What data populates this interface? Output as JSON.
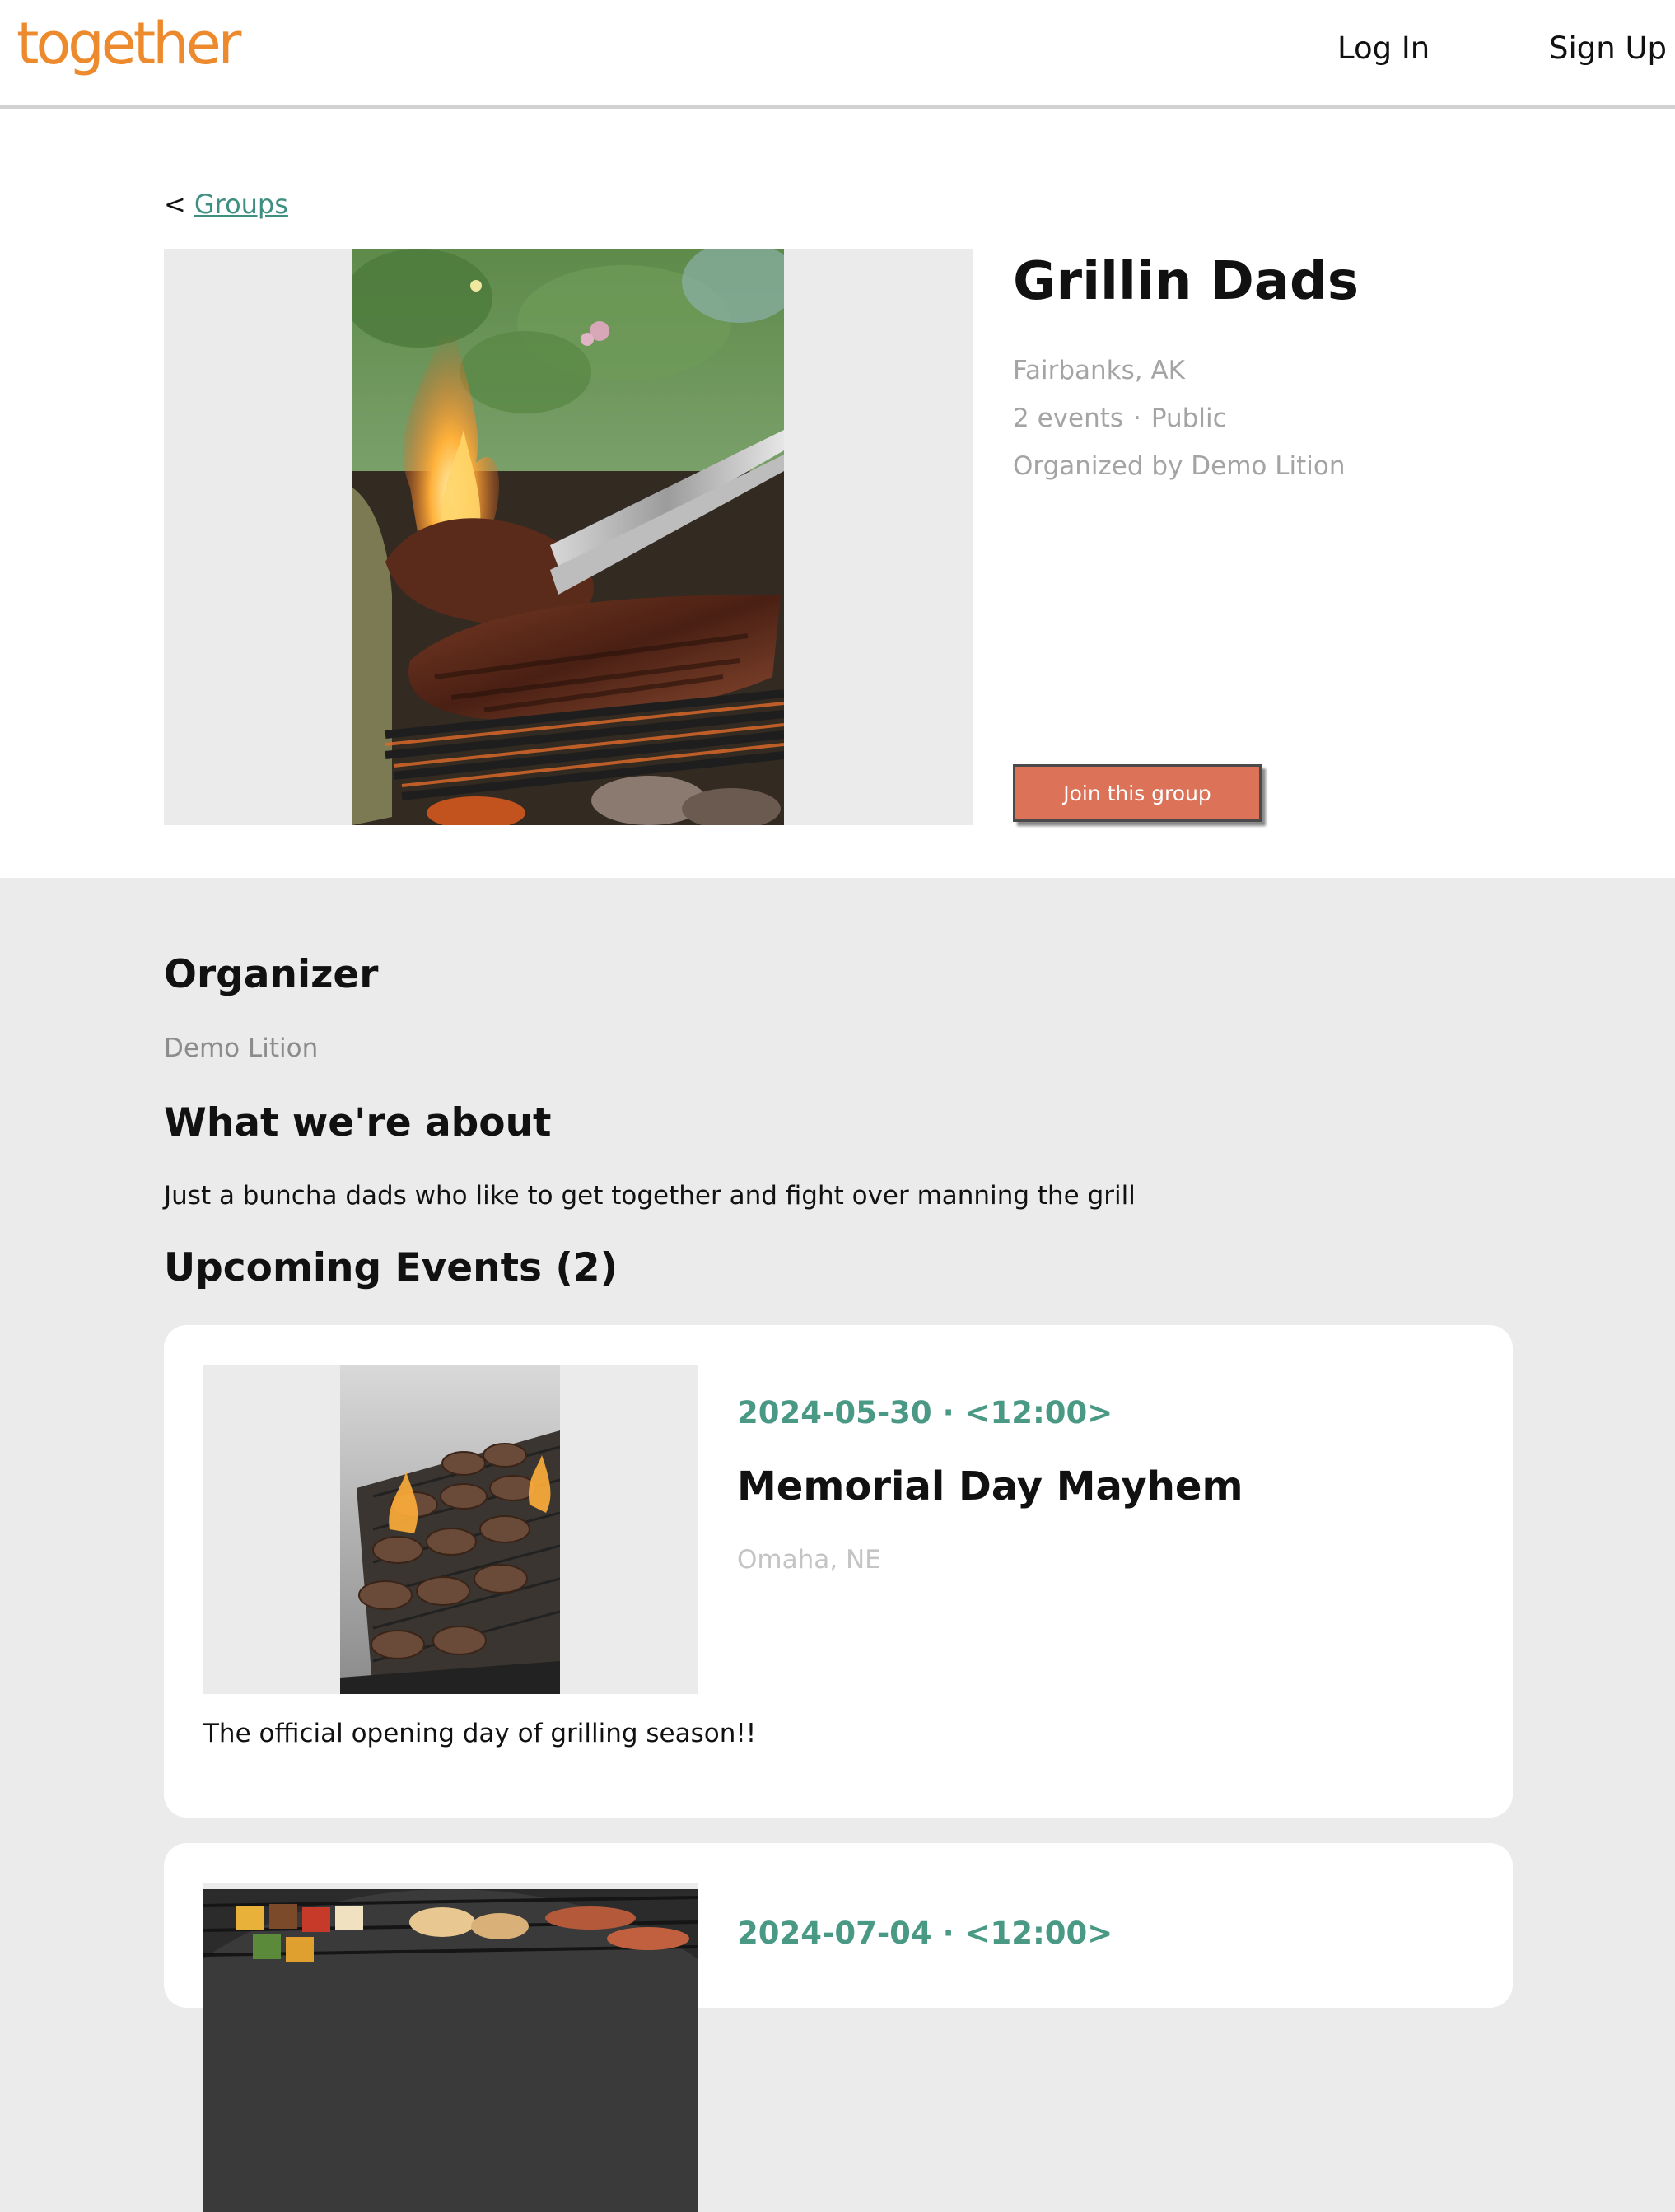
{
  "header": {
    "logo_text": "together",
    "login_label": "Log In",
    "signup_label": "Sign Up",
    "brand_color": "#ec8a2d"
  },
  "breadcrumb": {
    "arrow": "<",
    "label": "Groups"
  },
  "group": {
    "title": "Grillin Dads",
    "location": "Fairbanks, AK",
    "event_count": "2 events",
    "separator": "·",
    "visibility": "Public",
    "organized_by": "Organized by Demo Lition",
    "join_label": "Join this group",
    "join_color": "#dc7358"
  },
  "organizer": {
    "heading": "Organizer",
    "name": "Demo Lition"
  },
  "about": {
    "heading": "What we're about",
    "text": "Just a buncha dads who like to get together and fight over manning the grill"
  },
  "events": {
    "heading": "Upcoming Events (2)",
    "accent_color": "#4a9985",
    "items": [
      {
        "date": "2024-05-30",
        "time": "<12:00>",
        "separator": "·",
        "title": "Memorial Day Mayhem",
        "location": "Omaha, NE",
        "description": "The official opening day of grilling season!!"
      },
      {
        "date": "2024-07-04",
        "time": "<12:00>",
        "separator": "·"
      }
    ]
  }
}
